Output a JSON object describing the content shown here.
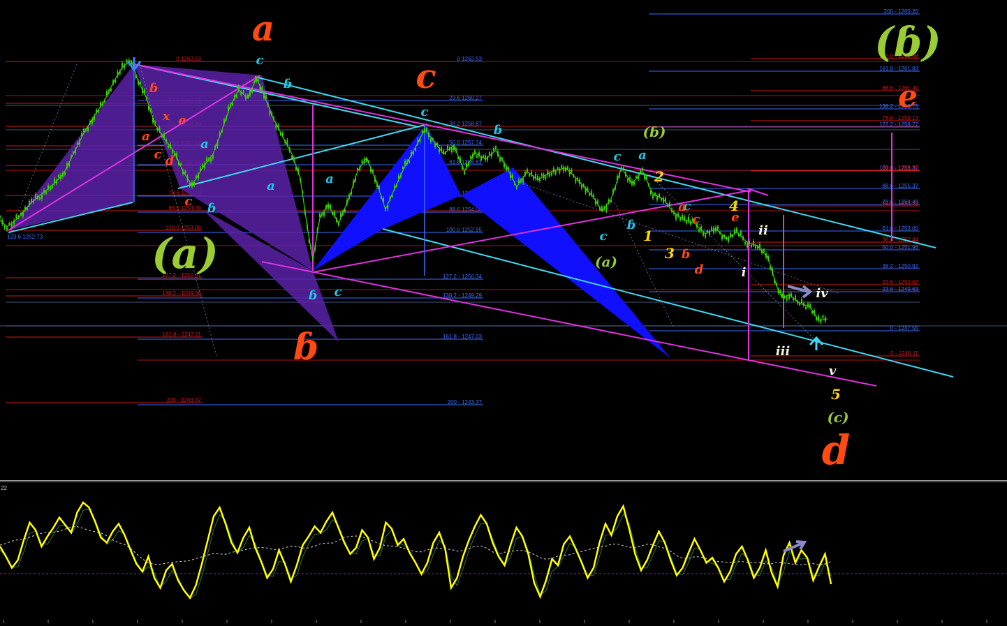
{
  "chart_data": {
    "type": "line",
    "title": "",
    "xlabel": "",
    "ylabel": "",
    "colors": {
      "background": "#000000",
      "candles": "#39d100",
      "fib_red": "#d01818",
      "fib_blue": "#3a6cff",
      "channel_cyan": "#3fd8f0",
      "channel_magenta": "#e032e0",
      "harmonic_blue": "#1010ff",
      "harmonic_purple": "#5a22a8",
      "oscillator_main": "#ffff00",
      "oscillator_signal": "#2a7a2a",
      "oscillator_avg": "#d8d8d8",
      "oscillator_zero": "#a0208a"
    },
    "price_path": {
      "ylim": [
        1242.5,
        1266.5
      ],
      "x": [
        0,
        10,
        20,
        30,
        45,
        60,
        75,
        90,
        105,
        120,
        135,
        150,
        162,
        175,
        188,
        198,
        210,
        222,
        235,
        250,
        262,
        275,
        290,
        305,
        318,
        330,
        342,
        355,
        367,
        378,
        392,
        405,
        418,
        430,
        440,
        448,
        458,
        470,
        485,
        500,
        512,
        525,
        540,
        552,
        565,
        580,
        595,
        608,
        620,
        635,
        650,
        665,
        680,
        695,
        710,
        725,
        740,
        755,
        770,
        790,
        810,
        830,
        850,
        862,
        875,
        890,
        905,
        920,
        935,
        950,
        965,
        980,
        995,
        1010,
        1025,
        1040,
        1055,
        1070,
        1085,
        1100,
        1112,
        1120,
        1130,
        1145,
        1160,
        1172,
        1185
      ],
      "y": [
        1253.4,
        1253.0,
        1253.3,
        1253.7,
        1254.4,
        1254.9,
        1255.4,
        1256.0,
        1257.2,
        1258.4,
        1259.4,
        1260.3,
        1261.3,
        1262.2,
        1262.6,
        1261.4,
        1260.4,
        1258.9,
        1258.1,
        1257.3,
        1256.2,
        1255.4,
        1256.4,
        1257.2,
        1258.6,
        1260.0,
        1260.9,
        1260.4,
        1261.6,
        1260.6,
        1259.2,
        1258.2,
        1257.2,
        1255.8,
        1253.0,
        1251.1,
        1253.5,
        1254.3,
        1253.2,
        1254.7,
        1256.2,
        1257.0,
        1255.5,
        1254.0,
        1255.2,
        1256.5,
        1257.6,
        1258.6,
        1258.0,
        1257.2,
        1257.7,
        1256.2,
        1257.3,
        1256.9,
        1257.4,
        1256.5,
        1255.3,
        1256.2,
        1255.7,
        1256.2,
        1256.4,
        1255.6,
        1254.7,
        1253.9,
        1254.6,
        1256.4,
        1255.5,
        1256.2,
        1254.9,
        1254.6,
        1253.8,
        1253.4,
        1253.2,
        1252.6,
        1252.9,
        1252.3,
        1252.7,
        1252.1,
        1251.9,
        1251.2,
        1249.6,
        1248.9,
        1249.1,
        1248.6,
        1248.4,
        1247.6,
        1247.7
      ]
    },
    "fib_groups": [
      {
        "color": "red",
        "label_x": 288,
        "lines": [
          [
            "0",
            "1262.53"
          ],
          [
            "23.6",
            "1260.28"
          ],
          [
            "38.2",
            "1258.89"
          ],
          [
            "50.0",
            "1257.76"
          ],
          [
            "61.8",
            "1256.64"
          ],
          [
            "78.6",
            "1255.04"
          ],
          [
            "88.6",
            "1254.09"
          ],
          [
            "100.0",
            "1253.00"
          ],
          [
            "127.2",
            "1250.41"
          ],
          [
            "138.2",
            "1249.36"
          ],
          [
            "161.8",
            "1247.11"
          ],
          [
            "200",
            "1243.47"
          ]
        ]
      },
      {
        "color": "blue",
        "label_x": 690,
        "lines": [
          [
            "0",
            "1262.53"
          ],
          [
            "23.6",
            "1260.27"
          ],
          [
            "38.2",
            "1258.87"
          ],
          [
            "50.0",
            "1257.74"
          ],
          [
            "61.8",
            "1256.61"
          ],
          [
            "78.6",
            "1255.00"
          ],
          [
            "88.6",
            "1254.04"
          ],
          [
            "100.0",
            "1252.95"
          ],
          [
            "127.2",
            "1250.34"
          ],
          [
            "138.2",
            "1249.29"
          ],
          [
            "161.8",
            "1247.03"
          ],
          [
            "200",
            "1243.37"
          ]
        ]
      },
      {
        "color": "blue",
        "label_x": 1315,
        "lines": [
          [
            "200",
            "1265.20"
          ],
          [
            "161.8",
            "1261.83"
          ],
          [
            "138.2",
            "1259.75"
          ],
          [
            "127.2",
            "1258.77"
          ],
          [
            "100.0",
            "1256.37"
          ],
          [
            "88.6",
            "1255.37"
          ],
          [
            "78.6",
            "1254.49"
          ],
          [
            "61.8",
            "1253.00"
          ],
          [
            "50.0",
            "1251.96"
          ],
          [
            "38.2",
            "1250.92"
          ],
          [
            "23.6",
            "1249.63"
          ],
          [
            "0",
            "1247.55"
          ]
        ]
      },
      {
        "color": "red",
        "label_x": 1315,
        "lines": [
          [
            "100.0",
            "1262.68"
          ],
          [
            "88.6",
            "1261.49"
          ],
          [
            "78.6",
            "1259.13"
          ],
          [
            "61.8",
            "1256.35"
          ],
          [
            "50.0",
            "1254.39"
          ],
          [
            "38.2",
            "1252.44"
          ],
          [
            "23.6",
            "1250.02"
          ],
          [
            "0",
            "1246.11"
          ]
        ]
      }
    ],
    "left_price_tag": {
      "label": "123.6",
      "value": "1252.73"
    },
    "wave_labels": [
      {
        "text": "a",
        "color": "#ff4a12",
        "size": "large"
      },
      {
        "text": "c",
        "color": "#ff4a12",
        "size": "large"
      },
      {
        "text": "ɓ",
        "color": "#ff4a12",
        "size": "large"
      },
      {
        "text": "d",
        "color": "#ff4a12",
        "size": "large"
      },
      {
        "text": "e",
        "color": "#ff4a12",
        "size": "large"
      },
      {
        "text": "(a)",
        "color": "#9acd32",
        "size": "large"
      },
      {
        "text": "(ɓ)",
        "color": "#9acd32",
        "size": "large"
      },
      {
        "text": "(ɓ)",
        "color": "#9acd32",
        "size": "medium"
      },
      {
        "text": "(a)",
        "color": "#9acd32",
        "size": "medium"
      },
      {
        "text": "(c)",
        "color": "#9acd32",
        "size": "medium"
      },
      {
        "text": "c",
        "color": "#20c8e8",
        "size": "small"
      },
      {
        "text": "ɓ",
        "color": "#20c8e8",
        "size": "small"
      },
      {
        "text": "a",
        "color": "#20c8e8",
        "size": "small"
      },
      {
        "text": "a",
        "color": "#20c8e8",
        "size": "small"
      },
      {
        "text": "ɓ",
        "color": "#20c8e8",
        "size": "small"
      },
      {
        "text": "c",
        "color": "#20c8e8",
        "size": "small"
      },
      {
        "text": "ɓ",
        "color": "#20c8e8",
        "size": "small"
      },
      {
        "text": "a",
        "color": "#20c8e8",
        "size": "small"
      },
      {
        "text": "c",
        "color": "#20c8e8",
        "size": "small"
      },
      {
        "text": "ɓ",
        "color": "#20c8e8",
        "size": "small"
      },
      {
        "text": "c",
        "color": "#20c8e8",
        "size": "small"
      },
      {
        "text": "ɓ",
        "color": "#20c8e8",
        "size": "small"
      },
      {
        "text": "c",
        "color": "#20c8e8",
        "size": "small"
      },
      {
        "text": "a",
        "color": "#20c8e8",
        "size": "small"
      },
      {
        "text": "c",
        "color": "#20c8e8",
        "size": "small"
      },
      {
        "text": "ɓ",
        "color": "#ff4a12",
        "size": "small"
      },
      {
        "text": "a",
        "color": "#ff4a12",
        "size": "small"
      },
      {
        "text": "x",
        "color": "#ff4a12",
        "size": "small"
      },
      {
        "text": "c",
        "color": "#ff4a12",
        "size": "small"
      },
      {
        "text": "e",
        "color": "#ff4a12",
        "size": "small"
      },
      {
        "text": "d",
        "color": "#ff4a12",
        "size": "small"
      },
      {
        "text": "c",
        "color": "#ff4a12",
        "size": "small"
      },
      {
        "text": "a",
        "color": "#ff4a12",
        "size": "small"
      },
      {
        "text": "c",
        "color": "#ff4a12",
        "size": "small"
      },
      {
        "text": "ɓ",
        "color": "#ff4a12",
        "size": "small"
      },
      {
        "text": "d",
        "color": "#ff4a12",
        "size": "small"
      },
      {
        "text": "e",
        "color": "#ff4a12",
        "size": "small"
      },
      {
        "text": "1",
        "color": "#ffd700",
        "size": "small"
      },
      {
        "text": "2",
        "color": "#ffd700",
        "size": "small"
      },
      {
        "text": "3",
        "color": "#ffd700",
        "size": "small"
      },
      {
        "text": "4",
        "color": "#ffd700",
        "size": "small"
      },
      {
        "text": "5",
        "color": "#ffd700",
        "size": "small"
      },
      {
        "text": "i",
        "color": "#f5f5dc",
        "size": "small"
      },
      {
        "text": "ii",
        "color": "#f5f5dc",
        "size": "small"
      },
      {
        "text": "iii",
        "color": "#f5f5dc",
        "size": "small"
      },
      {
        "text": "iv",
        "color": "#f5f5dc",
        "size": "small"
      },
      {
        "text": "v",
        "color": "#f5f5dc",
        "size": "small"
      }
    ],
    "oscillator": {
      "panel_label": "22",
      "ylim": [
        0,
        100
      ],
      "zero_level": 50,
      "values": [
        55,
        47,
        38,
        44,
        60,
        74,
        68,
        55,
        63,
        70,
        78,
        72,
        66,
        82,
        90,
        86,
        75,
        62,
        58,
        67,
        73,
        64,
        52,
        41,
        35,
        47,
        30,
        22,
        36,
        41,
        28,
        20,
        14,
        24,
        41,
        60,
        79,
        86,
        73,
        58,
        50,
        62,
        70,
        54,
        43,
        30,
        37,
        52,
        41,
        27,
        40,
        56,
        63,
        71,
        66,
        75,
        82,
        70,
        58,
        49,
        54,
        68,
        62,
        45,
        54,
        74,
        69,
        56,
        61,
        50,
        42,
        33,
        42,
        58,
        66,
        53,
        22,
        30,
        47,
        60,
        71,
        80,
        73,
        58,
        47,
        40,
        56,
        70,
        63,
        49,
        26,
        15,
        28,
        45,
        40,
        57,
        63,
        53,
        42,
        30,
        38,
        58,
        73,
        64,
        79,
        87,
        69,
        49,
        36,
        44,
        56,
        67,
        58,
        44,
        32,
        38,
        50,
        61,
        52,
        42,
        46,
        38,
        27,
        35,
        49,
        55,
        44,
        30,
        38,
        52,
        34,
        23,
        48,
        58,
        42,
        52,
        46,
        28,
        39,
        49,
        25
      ]
    }
  }
}
